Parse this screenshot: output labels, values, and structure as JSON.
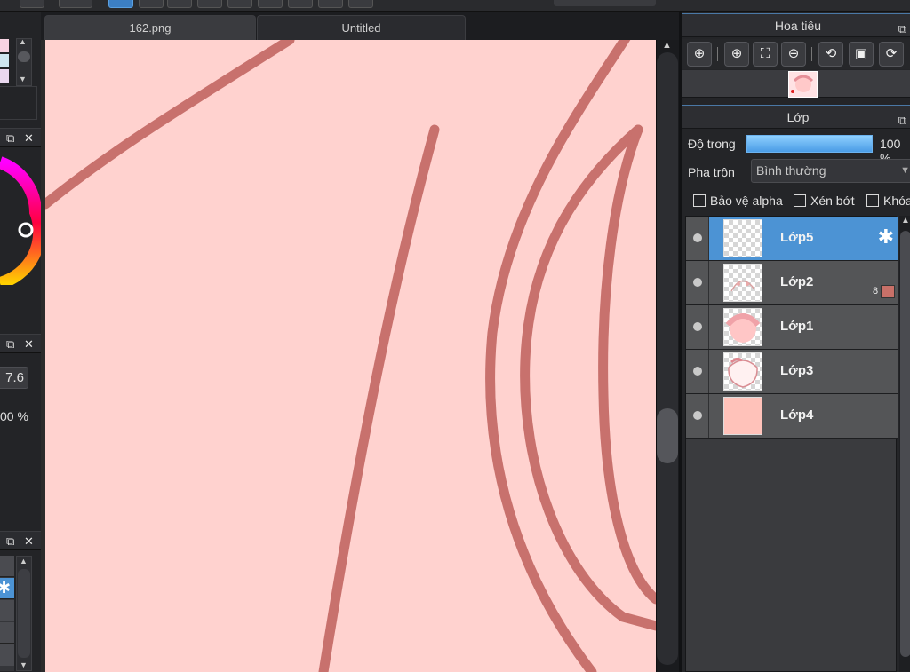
{
  "tabs": [
    {
      "label": "162.png",
      "active": true
    },
    {
      "label": "Untitled",
      "active": false
    }
  ],
  "left_panel": {
    "numeric_value": "7.6",
    "percent_text": "00 %"
  },
  "navigator": {
    "title": "Hoa tiêu",
    "tools": [
      "zoom-fit-icon",
      "zoom-in-icon",
      "fit-screen-icon",
      "zoom-out-icon",
      "rotate-left-icon",
      "actual-size-icon",
      "rotate-right-icon"
    ]
  },
  "layers_panel": {
    "title": "Lớp",
    "opacity_label": "Độ trong",
    "opacity_value_text": "100 %",
    "opacity_fraction": 1.0,
    "blend_label": "Pha trộn",
    "blend_value": "Bình thường",
    "checkboxes": [
      {
        "label": "Bảo vệ alpha",
        "checked": false
      },
      {
        "label": "Xén bớt",
        "checked": false
      },
      {
        "label": "Khóa",
        "checked": false
      }
    ],
    "layers": [
      {
        "name": "Lớp5",
        "selected": true,
        "thumb": "transparent"
      },
      {
        "name": "Lớp2",
        "selected": false,
        "thumb": "sketch",
        "count": "8",
        "color": "#c87068"
      },
      {
        "name": "Lớp1",
        "selected": false,
        "thumb": "character"
      },
      {
        "name": "Lớp3",
        "selected": false,
        "thumb": "character-lines"
      },
      {
        "name": "Lớp4",
        "selected": false,
        "thumb": "fill"
      }
    ]
  },
  "colors": {
    "canvas_bg": "#ffd2cf",
    "stroke": "#c8716d",
    "accent": "#4c93d4"
  }
}
